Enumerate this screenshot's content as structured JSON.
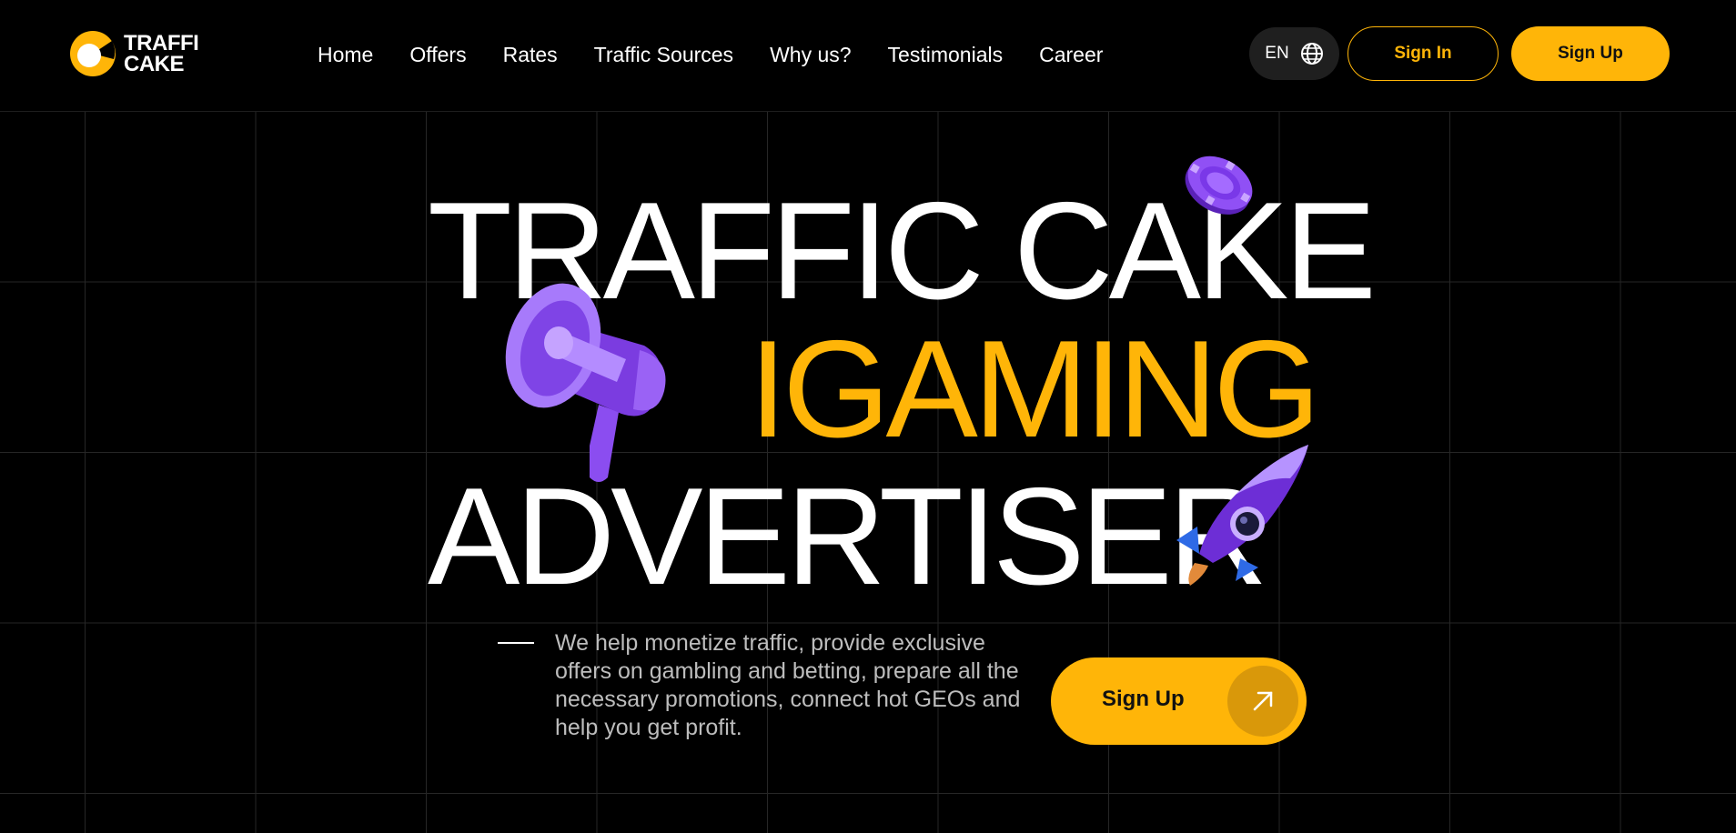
{
  "header": {
    "logo": {
      "line1": "TRAFFI",
      "line2": "CAKE",
      "icon": "cake-logo-icon"
    },
    "nav": [
      {
        "label": "Home"
      },
      {
        "label": "Offers"
      },
      {
        "label": "Rates"
      },
      {
        "label": "Traffic Sources"
      },
      {
        "label": "Why us?"
      },
      {
        "label": "Testimonials"
      },
      {
        "label": "Career"
      }
    ],
    "language": {
      "value": "EN",
      "icon": "globe-icon"
    },
    "signin_label": "Sign In",
    "signup_label": "Sign Up"
  },
  "hero": {
    "line1": "TRAFFIC CAKE",
    "line2": "IGAMING",
    "line3": "ADVERTISER",
    "description": "We help monetize traffic, provide exclusive offers on gambling and betting, prepare all the necessary promotions, connect hot GEOs and help you get profit.",
    "cta_label": "Sign Up",
    "cta_icon": "arrow-up-right-icon",
    "decorations": [
      "megaphone-icon",
      "casino-chip-icon",
      "rocket-icon"
    ]
  },
  "colors": {
    "accent": "#FFB508",
    "background": "#000000",
    "purple": "#8B4DF0"
  }
}
